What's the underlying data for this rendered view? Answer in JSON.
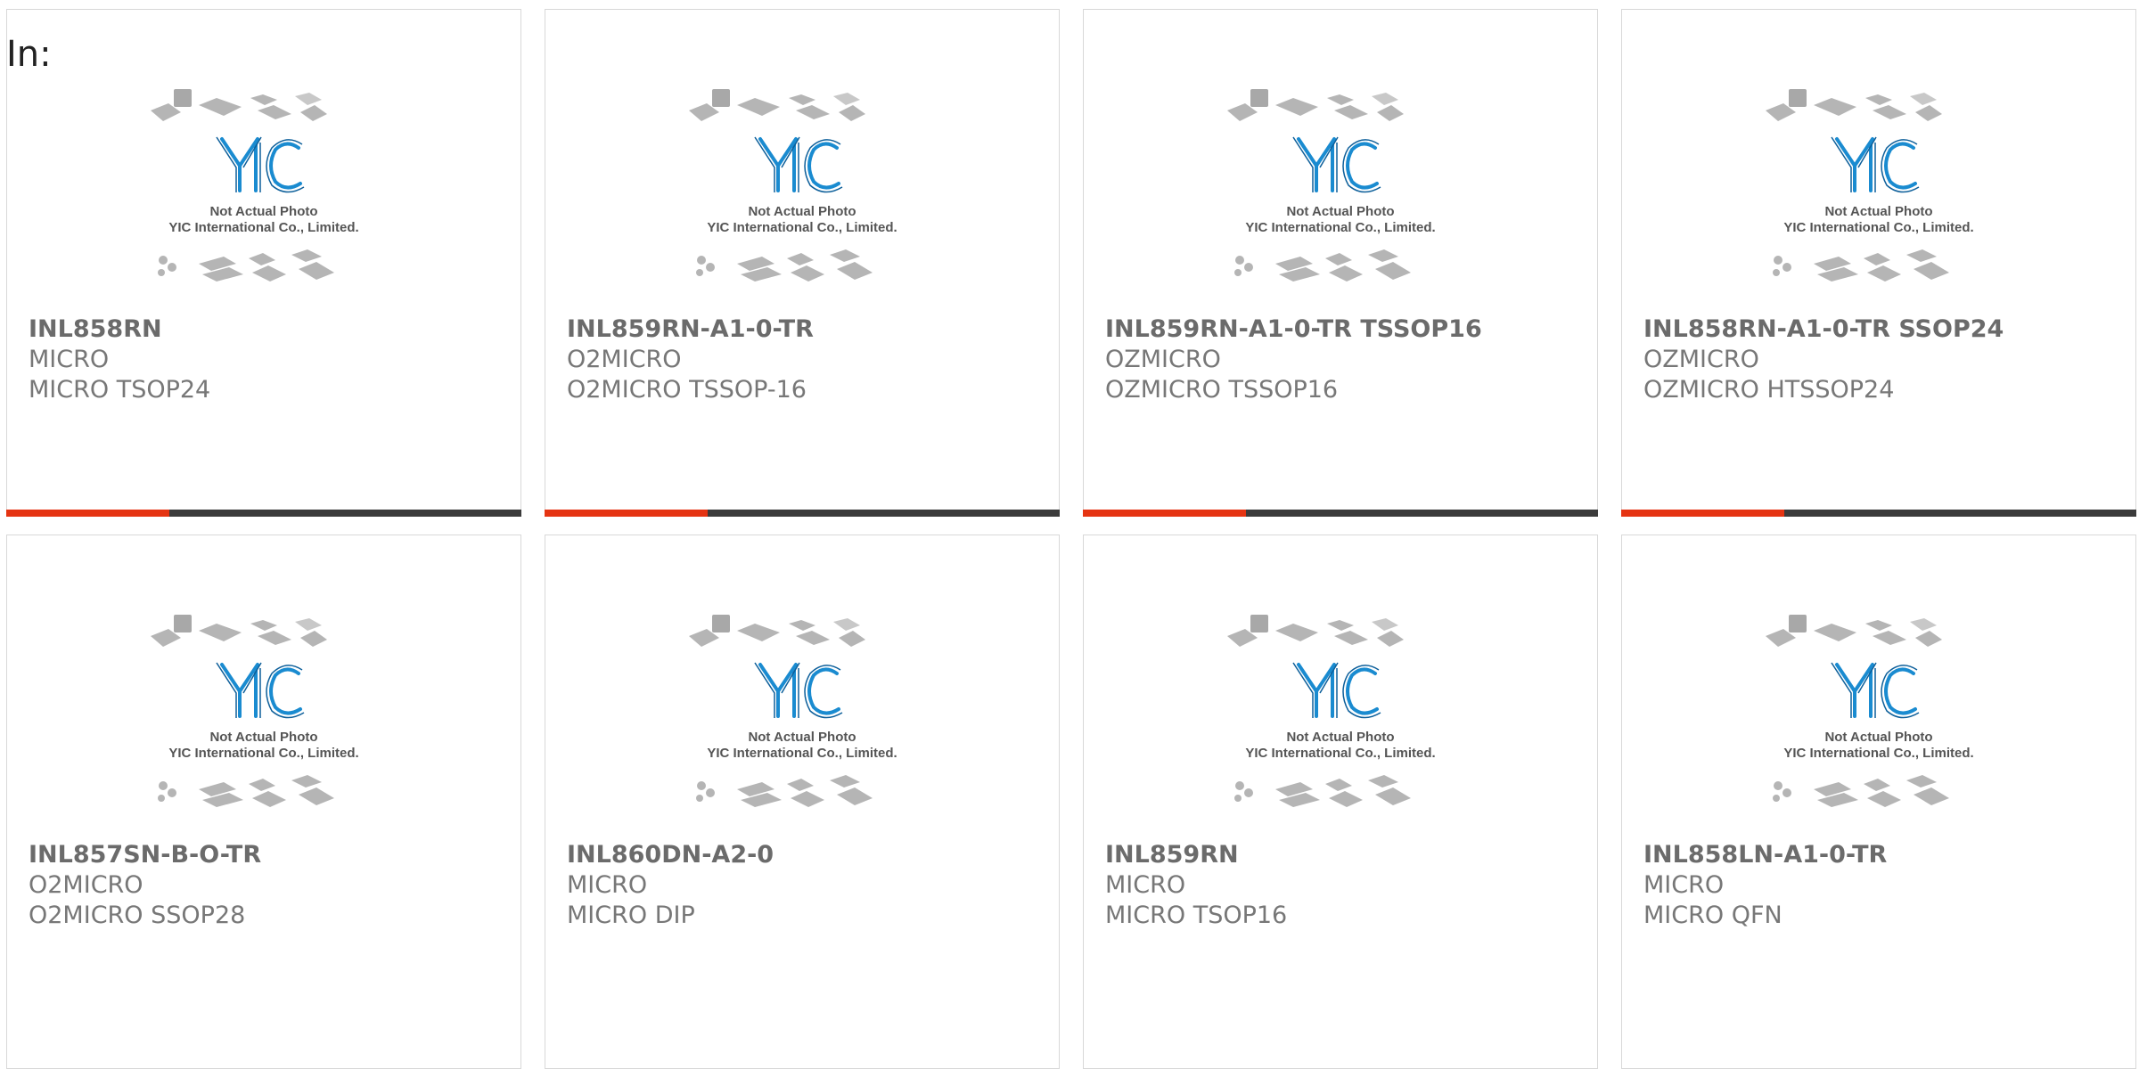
{
  "header": {
    "label": "In:"
  },
  "placeholder_image": {
    "brand": "YIC",
    "caption_line1": "Not Actual Photo",
    "caption_line2": "YIC International Co., Limited."
  },
  "products": [
    {
      "part_number": "INL858RN",
      "manufacturer": "MICRO",
      "package": "MICRO TSOP24"
    },
    {
      "part_number": "INL859RN-A1-0-TR",
      "manufacturer": "O2MICRO",
      "package": "O2MICRO TSSOP-16"
    },
    {
      "part_number": "INL859RN-A1-0-TR TSSOP16",
      "manufacturer": "OZMICRO",
      "package": "OZMICRO TSSOP16"
    },
    {
      "part_number": "INL858RN-A1-0-TR SSOP24",
      "manufacturer": "OZMICRO",
      "package": "OZMICRO HTSSOP24"
    },
    {
      "part_number": "INL857SN-B-O-TR",
      "manufacturer": "O2MICRO",
      "package": "O2MICRO SSOP28"
    },
    {
      "part_number": "INL860DN-A2-0",
      "manufacturer": "MICRO",
      "package": "MICRO DIP"
    },
    {
      "part_number": "INL859RN",
      "manufacturer": "MICRO",
      "package": "MICRO TSOP16"
    },
    {
      "part_number": "INL858LN-A1-0-TR",
      "manufacturer": "MICRO",
      "package": "MICRO QFN"
    }
  ],
  "colors": {
    "accent": "#e53412",
    "bar": "#3b3b3b",
    "logo": "#1a8bd0",
    "chip": "#b8b8b8"
  }
}
